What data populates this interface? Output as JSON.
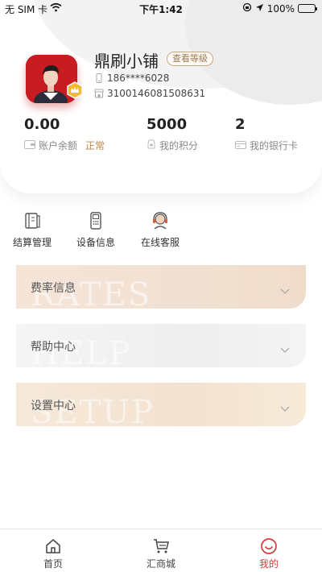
{
  "status_bar": {
    "carrier": "无 SIM 卡",
    "time": "下午1:42",
    "battery": "100%"
  },
  "profile": {
    "shop_name": "鼎刷小铺",
    "level_button": "查看等级",
    "phone": "186****6028",
    "merchant_id": "3100146081508631"
  },
  "stats": {
    "balance": {
      "value": "0.00",
      "label": "账户余额",
      "status": "正常"
    },
    "points": {
      "value": "5000",
      "label": "我的积分"
    },
    "cards": {
      "value": "2",
      "label": "我的银行卡"
    }
  },
  "quick_actions": [
    {
      "label": "结算管理",
      "icon": "settlement-icon"
    },
    {
      "label": "设备信息",
      "icon": "pos-device-icon"
    },
    {
      "label": "在线客服",
      "icon": "customer-service-icon"
    }
  ],
  "sections": [
    {
      "title": "费率信息",
      "watermark": "RATES"
    },
    {
      "title": "帮助中心",
      "watermark": "HELP"
    },
    {
      "title": "设置中心",
      "watermark": "SETUP"
    }
  ],
  "tabs": [
    {
      "label": "首页",
      "icon": "home-icon",
      "active": false
    },
    {
      "label": "汇商城",
      "icon": "cart-icon",
      "active": false
    },
    {
      "label": "我的",
      "icon": "smile-icon",
      "active": true
    }
  ],
  "colors": {
    "accent": "#d23b3b",
    "avatar_bg": "#c71c22",
    "gold": "#b8874a"
  }
}
